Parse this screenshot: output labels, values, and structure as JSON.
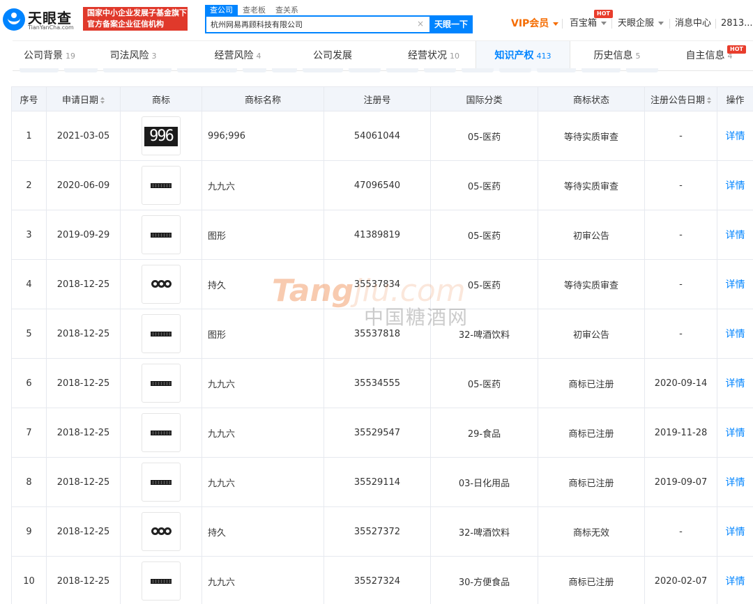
{
  "header": {
    "logo_cn": "天眼查",
    "logo_en": "TianYanCha.com",
    "gov_badge_line1": "国家中小企业发展子基金旗下",
    "gov_badge_line2": "官方备案企业征信机构",
    "search_tabs": [
      "查公司",
      "查老板",
      "查关系"
    ],
    "search_value": "杭州网易再顾科技有限公司",
    "search_button": "天眼一下",
    "vip": "VIP会员",
    "baibaoxiang": "百宝箱",
    "hot": "HOT",
    "qiye": "天眼企服",
    "messages": "消息中心",
    "user": "2813..."
  },
  "tabs": [
    {
      "label": "公司背景",
      "count": "19"
    },
    {
      "label": "司法风险",
      "count": "3"
    },
    {
      "label": "经营风险",
      "count": "4"
    },
    {
      "label": "公司发展",
      "count": ""
    },
    {
      "label": "经营状况",
      "count": "10"
    },
    {
      "label": "知识产权",
      "count": "413"
    },
    {
      "label": "历史信息",
      "count": "5"
    },
    {
      "label": "自主信息",
      "count": "4"
    }
  ],
  "active_tab": 5,
  "table": {
    "headers": [
      "序号",
      "申请日期",
      "商标",
      "商标名称",
      "注册号",
      "国际分类",
      "商标状态",
      "注册公告日期",
      "操作"
    ],
    "rows": [
      {
        "no": "1",
        "date": "2021-03-05",
        "logo": "996-block",
        "name": "996;996",
        "reg": "54061044",
        "cls": "05-医药",
        "status": "等待实质审查",
        "pub": "-",
        "op": "详情"
      },
      {
        "no": "2",
        "date": "2020-06-09",
        "logo": "stripe",
        "name": "九九六",
        "reg": "47096540",
        "cls": "05-医药",
        "status": "等待实质审查",
        "pub": "-",
        "op": "详情"
      },
      {
        "no": "3",
        "date": "2019-09-29",
        "logo": "stripe",
        "name": "图形",
        "reg": "41389819",
        "cls": "05-医药",
        "status": "初审公告",
        "pub": "-",
        "op": "详情"
      },
      {
        "no": "4",
        "date": "2018-12-25",
        "logo": "rings",
        "name": "持久",
        "reg": "35537834",
        "cls": "05-医药",
        "status": "等待实质审查",
        "pub": "-",
        "op": "详情"
      },
      {
        "no": "5",
        "date": "2018-12-25",
        "logo": "stripe",
        "name": "图形",
        "reg": "35537818",
        "cls": "32-啤酒饮料",
        "status": "初审公告",
        "pub": "-",
        "op": "详情"
      },
      {
        "no": "6",
        "date": "2018-12-25",
        "logo": "stripe",
        "name": "九九六",
        "reg": "35534555",
        "cls": "05-医药",
        "status": "商标已注册",
        "pub": "2020-09-14",
        "op": "详情"
      },
      {
        "no": "7",
        "date": "2018-12-25",
        "logo": "stripe",
        "name": "九九六",
        "reg": "35529547",
        "cls": "29-食品",
        "status": "商标已注册",
        "pub": "2019-11-28",
        "op": "详情"
      },
      {
        "no": "8",
        "date": "2018-12-25",
        "logo": "stripe",
        "name": "九九六",
        "reg": "35529114",
        "cls": "03-日化用品",
        "status": "商标已注册",
        "pub": "2019-09-07",
        "op": "详情"
      },
      {
        "no": "9",
        "date": "2018-12-25",
        "logo": "rings",
        "name": "持久",
        "reg": "35527372",
        "cls": "32-啤酒饮料",
        "status": "商标无效",
        "pub": "-",
        "op": "详情"
      },
      {
        "no": "10",
        "date": "2018-12-25",
        "logo": "stripe",
        "name": "九九六",
        "reg": "35527324",
        "cls": "30-方便食品",
        "status": "商标已注册",
        "pub": "2020-02-07",
        "op": "详情"
      }
    ]
  },
  "trademark_996_text": "996",
  "watermark": {
    "en_bold": "Tang",
    "en_thin": "jiu.com",
    "cn": "中国糖酒网"
  },
  "colors": {
    "accent": "#0084ff",
    "vip": "#f56c00",
    "hot": "#e83d2c",
    "badge": "#e0392b"
  }
}
